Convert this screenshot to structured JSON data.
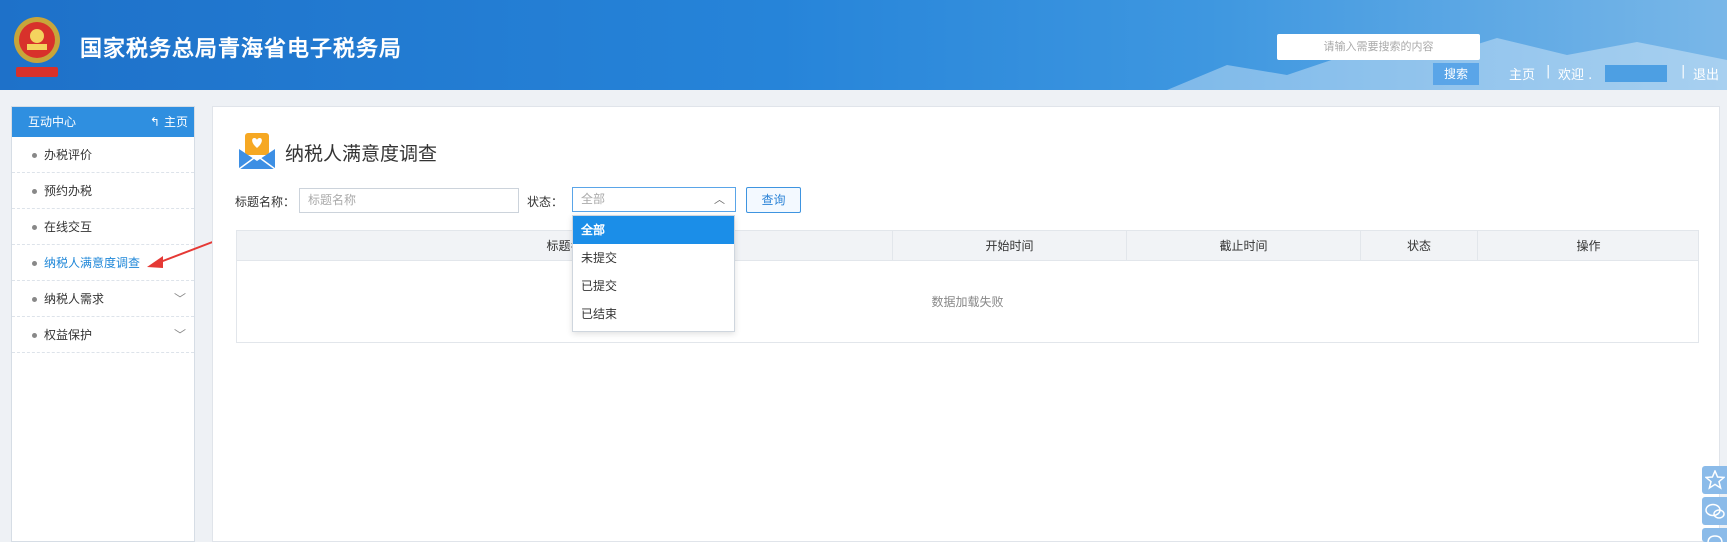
{
  "header": {
    "site_title": "国家税务总局青海省电子税务局",
    "search_placeholder": "请输入需要搜索的内容",
    "search_button": "搜索",
    "home_link": "主页",
    "separator": "|",
    "welcome_label": "欢迎 .",
    "logout_link": "退出"
  },
  "sidebar": {
    "heading": "互动中心",
    "home_link": "主页",
    "items": [
      {
        "label": "办税评价"
      },
      {
        "label": "预约办税"
      },
      {
        "label": "在线交互"
      },
      {
        "label": "纳税人满意度调查"
      },
      {
        "label": "纳税人需求"
      },
      {
        "label": "权益保护"
      }
    ]
  },
  "main": {
    "page_title": "纳税人满意度调查",
    "filter": {
      "title_label": "标题名称：",
      "title_placeholder": "标题名称",
      "status_label": "状态：",
      "status_value": "全部",
      "query_button": "查询"
    },
    "table": {
      "columns": [
        "标题名",
        "开始时间",
        "截止时间",
        "状态",
        "操作"
      ],
      "empty_message": "数据加载失败"
    },
    "status_dropdown": {
      "options": [
        "全部",
        "未提交",
        "已提交",
        "已结束"
      ],
      "selected": "全部"
    }
  },
  "colors": {
    "header_blue": "#2684d9",
    "accent_blue": "#1b8ee8",
    "active_link": "#1f87d8",
    "annotation_arrow": "#e53935"
  }
}
